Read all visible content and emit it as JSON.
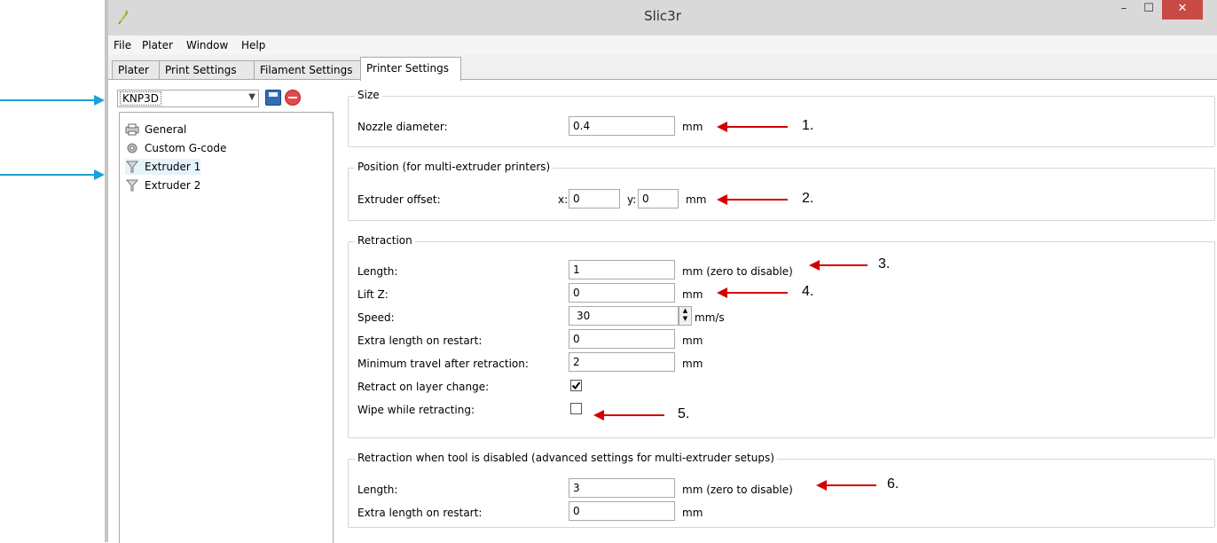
{
  "window": {
    "title": "Slic3r",
    "minimize_label": "–",
    "maximize_label": "☐",
    "close_label": "✕"
  },
  "menu": {
    "items": [
      "File",
      "Plater",
      "Window",
      "Help"
    ]
  },
  "tabs": [
    "Plater",
    "Print Settings",
    "Filament Settings",
    "Printer Settings"
  ],
  "active_tab": "Printer Settings",
  "preset": {
    "value": "KNP3D"
  },
  "tree": {
    "items": [
      {
        "label": "General",
        "icon": "printer-icon"
      },
      {
        "label": "Custom G-code",
        "icon": "gear-icon"
      },
      {
        "label": "Extruder 1",
        "icon": "funnel-icon"
      },
      {
        "label": "Extruder 2",
        "icon": "funnel-icon"
      }
    ],
    "selected": "Extruder 1"
  },
  "size": {
    "title": "Size",
    "nozzle_label": "Nozzle diameter:",
    "nozzle_value": "0.4",
    "nozzle_unit": "mm"
  },
  "position": {
    "title": "Position (for multi-extruder printers)",
    "offset_label": "Extruder offset:",
    "x_label": "x:",
    "x_value": "0",
    "y_label": "y:",
    "y_value": "0",
    "unit": "mm"
  },
  "retraction": {
    "title": "Retraction",
    "length_label": "Length:",
    "length_value": "1",
    "length_unit": "mm (zero to disable)",
    "liftz_label": "Lift Z:",
    "liftz_value": "0",
    "liftz_unit": "mm",
    "speed_label": "Speed:",
    "speed_value": "30",
    "speed_unit": "mm/s",
    "extra_label": "Extra length on restart:",
    "extra_value": "0",
    "extra_unit": "mm",
    "mintravel_label": "Minimum travel after retraction:",
    "mintravel_value": "2",
    "mintravel_unit": "mm",
    "layerchange_label": "Retract on layer change:",
    "layerchange_checked": true,
    "wipe_label": "Wipe while retracting:",
    "wipe_checked": false
  },
  "retraction_disabled": {
    "title": "Retraction when tool is disabled (advanced settings for multi-extruder setups)",
    "length_label": "Length:",
    "length_value": "3",
    "length_unit": "mm (zero to disable)",
    "extra_label": "Extra length on restart:",
    "extra_value": "0",
    "extra_unit": "mm"
  },
  "annotations": {
    "numbers": [
      "1.",
      "2.",
      "3.",
      "4.",
      "5.",
      "6."
    ]
  },
  "colors": {
    "annotation_red": "#d40000",
    "annotation_blue": "#1aa0d8",
    "close_button": "#c74a45"
  }
}
